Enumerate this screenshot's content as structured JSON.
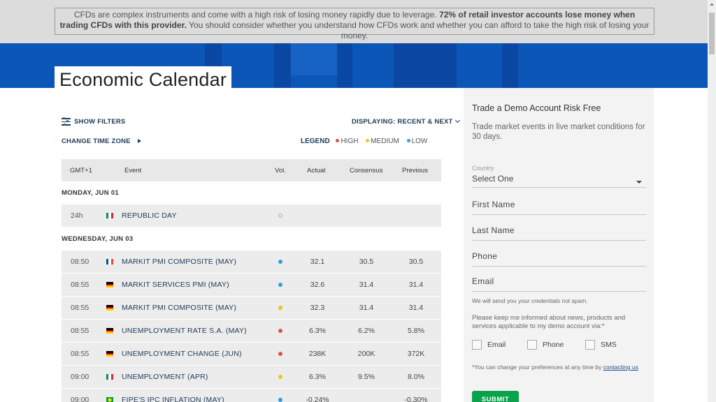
{
  "risk_warning": {
    "part1": "CFDs are complex instruments and come with a high risk of losing money rapidly due to leverage. ",
    "bold": "72% of retail investor accounts lose money when trading CFDs with this provider.",
    "part2": " You should consider whether you understand how CFDs work and whether you can afford to take the high risk of losing your money."
  },
  "page_title": "Economic Calendar",
  "controls": {
    "show_filters": "SHOW FILTERS",
    "displaying": "DISPLAYING: RECENT & NEXT",
    "change_time_zone": "CHANGE TIME ZONE",
    "legend_title": "LEGEND",
    "legend": [
      {
        "label": "HIGH",
        "color": "#d9534f"
      },
      {
        "label": "MEDIUM",
        "color": "#f0c419"
      },
      {
        "label": "LOW",
        "color": "#2f9fe0"
      }
    ]
  },
  "table": {
    "headers": {
      "time": "GMT+1",
      "event": "Event",
      "vol": "Vol.",
      "actual": "Actual",
      "consensus": "Consensus",
      "previous": "Previous"
    },
    "days": [
      {
        "label": "MONDAY, JUN 01"
      },
      {
        "label": "WEDNESDAY, JUN 03"
      }
    ],
    "rows": [
      {
        "time": "24h",
        "flag": "italy",
        "event": "REPUBLIC DAY",
        "vol": "none",
        "actual": "",
        "consensus": "",
        "previous": ""
      },
      {
        "time": "08:50",
        "flag": "france",
        "event": "MARKIT PMI COMPOSITE (MAY)",
        "vol": "low",
        "actual": "32.1",
        "consensus": "30.5",
        "previous": "30.5"
      },
      {
        "time": "08:55",
        "flag": "germany",
        "event": "MARKIT SERVICES PMI (MAY)",
        "vol": "low",
        "actual": "32.6",
        "consensus": "31.4",
        "previous": "31.4"
      },
      {
        "time": "08:55",
        "flag": "germany",
        "event": "MARKIT PMI COMPOSITE (MAY)",
        "vol": "medium",
        "actual": "32.3",
        "consensus": "31.4",
        "previous": "31.4"
      },
      {
        "time": "08:55",
        "flag": "germany",
        "event": "UNEMPLOYMENT RATE S.A. (MAY)",
        "vol": "high",
        "actual": "6.3%",
        "consensus": "6.2%",
        "previous": "5.8%"
      },
      {
        "time": "08:55",
        "flag": "germany",
        "event": "UNEMPLOYMENT CHANGE (JUN)",
        "vol": "high",
        "actual": "238K",
        "consensus": "200K",
        "previous": "372K"
      },
      {
        "time": "09:00",
        "flag": "italy",
        "event": "UNEMPLOYMENT (APR)",
        "vol": "medium",
        "actual": "6.3%",
        "consensus": "9.5%",
        "previous": "8.0%"
      },
      {
        "time": "09:00",
        "flag": "brazil",
        "event": "FIPE'S IPC INFLATION (MAY)",
        "vol": "low",
        "actual": "-0.24%",
        "consensus": "",
        "previous": "-0.30%"
      }
    ]
  },
  "demo_form": {
    "title": "Trade a Demo Account Risk Free",
    "subtitle": "Trade market events in live market conditions for 30 days.",
    "country_label": "Country",
    "country_value": "Select One",
    "first_name": "First Name",
    "last_name": "Last Name",
    "phone": "Phone",
    "email": "Email",
    "credentials_note": "We will send you your credentials not spam.",
    "keep_informed": "Please keep me informed about news, products and services applicable to my demo account via:*",
    "check_email": "Email",
    "check_phone": "Phone",
    "check_sms": "SMS",
    "pref_note": "*You can change your preferences at any time by ",
    "pref_link": "contacting us",
    "submit": "SUBMIT"
  },
  "colors": {
    "vol_high": "#d9534f",
    "vol_medium": "#f0c419",
    "vol_low": "#2f9fe0",
    "hero_blue": "#0c56b7",
    "submit_green": "#0aa24c"
  }
}
